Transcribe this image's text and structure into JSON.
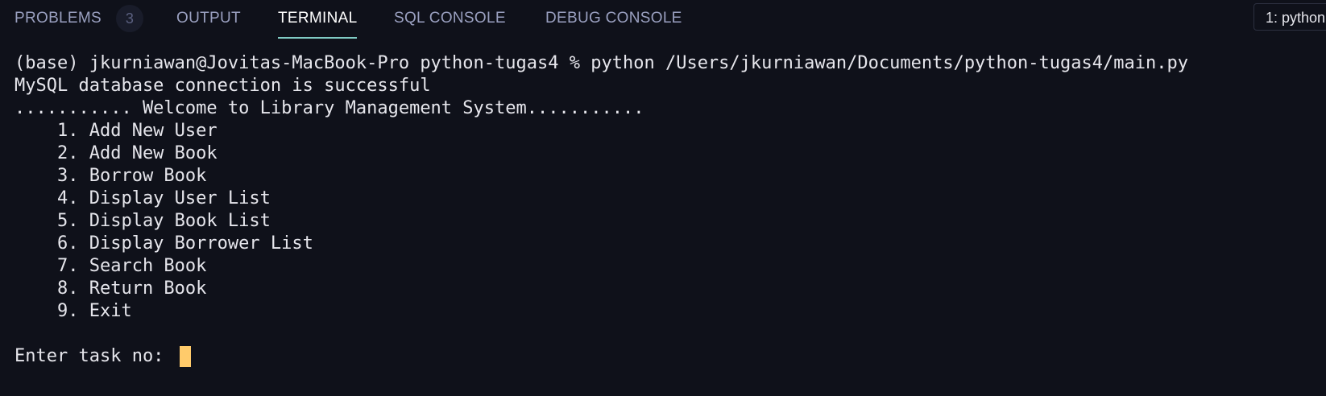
{
  "tabs": {
    "problems": {
      "label": "PROBLEMS",
      "count": "3"
    },
    "output": "OUTPUT",
    "terminal": "TERMINAL",
    "sql_console": "SQL CONSOLE",
    "debug_console": "DEBUG CONSOLE",
    "active": "TERMINAL"
  },
  "terminal_selector": "1: python",
  "terminal": {
    "command_line": "(base) jkurniawan@Jovitas-MacBook-Pro python-tugas4 % python /Users/jkurniawan/Documents/python-tugas4/main.py",
    "connection_message": "MySQL database connection is successful",
    "welcome_message": "........... Welcome to Library Management System...........",
    "menu": [
      "    1. Add New User",
      "    2. Add New Book",
      "    3. Borrow Book",
      "    4. Display User List",
      "    5. Display Book List",
      "    6. Display Borrower List",
      "    7. Search Book",
      "    8. Return Book",
      "    9. Exit"
    ],
    "input_prompt": "Enter task no: "
  },
  "colors": {
    "background": "#0f111a",
    "text": "#e6e6ec",
    "tab_inactive": "#9aa0c0",
    "tab_active_underline": "#80cbc4",
    "cursor": "#ffcb6b"
  }
}
